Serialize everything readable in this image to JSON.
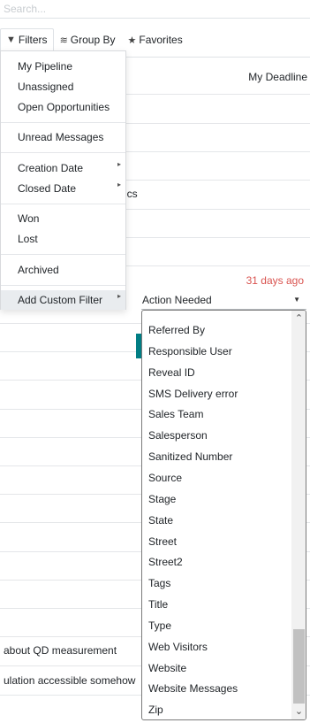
{
  "search": {
    "placeholder": "Search..."
  },
  "toolbar": {
    "filters_label": "Filters",
    "groupby_label": "Group By",
    "favorites_label": "Favorites"
  },
  "list": {
    "deadline_header": "My Deadline",
    "overdue_text": "31 days ago",
    "row_219_text": "ics",
    "row_735_text": "about QD measurement",
    "row_769_text": "ulation accessible somehow"
  },
  "filters_menu": {
    "my_pipeline": "My Pipeline",
    "unassigned": "Unassigned",
    "open_opportunities": "Open Opportunities",
    "unread_messages": "Unread Messages",
    "creation_date": "Creation Date",
    "closed_date": "Closed Date",
    "won": "Won",
    "lost": "Lost",
    "archived": "Archived",
    "add_custom_filter": "Add Custom Filter"
  },
  "custom_filter": {
    "selected_field": "Action Needed",
    "options": [
      "Referred By",
      "Responsible User",
      "Reveal ID",
      "SMS Delivery error",
      "Sales Team",
      "Salesperson",
      "Sanitized Number",
      "Source",
      "Stage",
      "State",
      "Street",
      "Street2",
      "Tags",
      "Title",
      "Type",
      "Web Visitors",
      "Website",
      "Website Messages",
      "Zip"
    ]
  },
  "colors": {
    "accent": "#017e84",
    "overdue": "#d9534f"
  }
}
